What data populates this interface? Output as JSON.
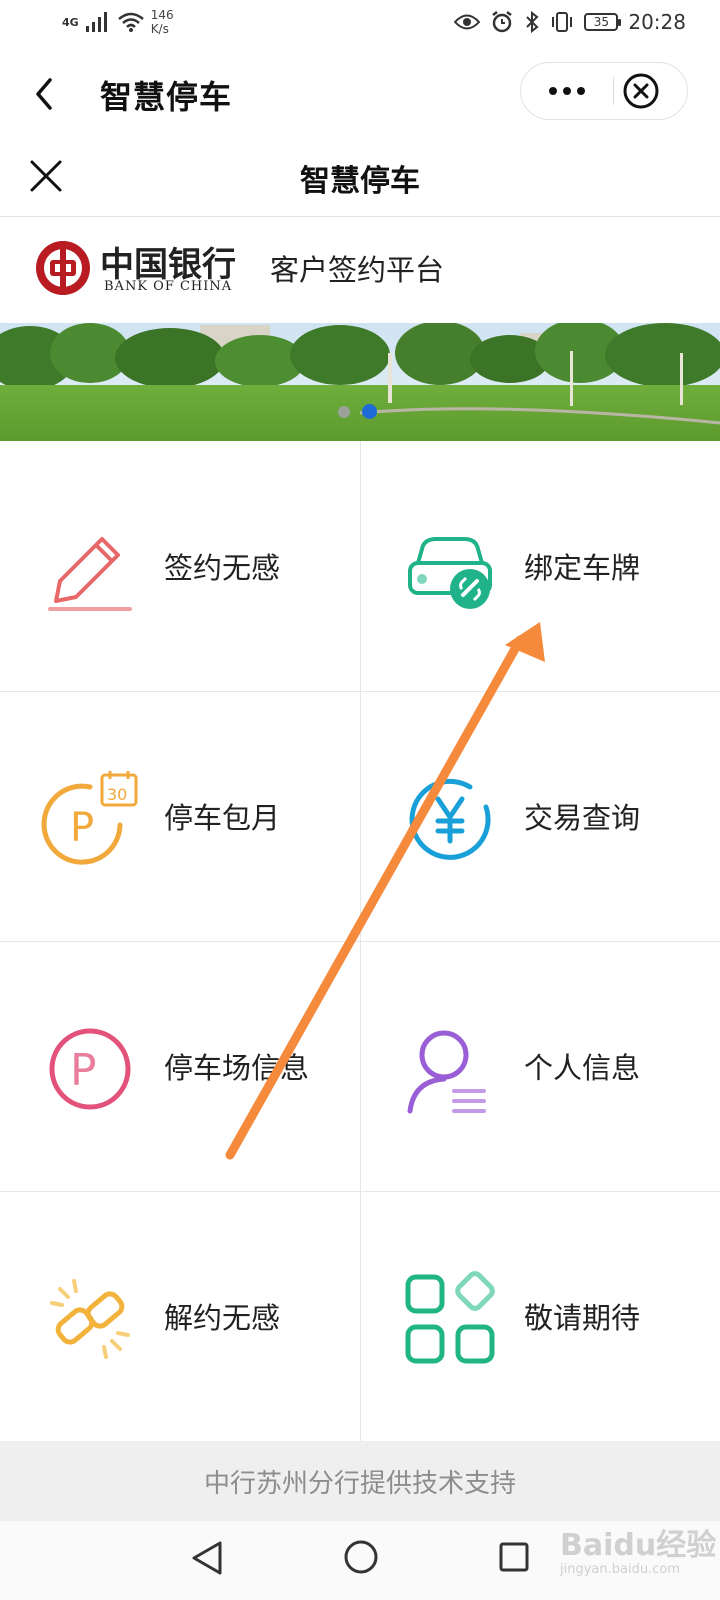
{
  "status_bar": {
    "network": "4G",
    "speed_value": "146",
    "speed_unit": "K/s",
    "battery": "35",
    "time": "20:28"
  },
  "mini_program": {
    "title": "智慧停车",
    "more_icon": "more-dots-icon",
    "close_icon": "close-circle-icon"
  },
  "page": {
    "title": "智慧停车"
  },
  "brand": {
    "logo_cn": "中国银行",
    "logo_en": "BANK OF CHINA",
    "platform": "客户签约平台"
  },
  "banner": {
    "slide_count": 2,
    "active_slide": 2
  },
  "menu": [
    {
      "label": "签约无感",
      "icon": "pencil-icon",
      "color": "#e8686a"
    },
    {
      "label": "绑定车牌",
      "icon": "car-link-icon",
      "color": "#20b38a"
    },
    {
      "label": "停车包月",
      "icon": "parking-calendar-icon",
      "color": "#f2a93b"
    },
    {
      "label": "交易查询",
      "icon": "yen-circle-icon",
      "color": "#1aa0d8"
    },
    {
      "label": "停车场信息",
      "icon": "parking-circle-icon",
      "color": "#e2527a"
    },
    {
      "label": "个人信息",
      "icon": "person-icon",
      "color": "#9a5fd6"
    },
    {
      "label": "解约无感",
      "icon": "broken-link-icon",
      "color": "#f2b23b"
    },
    {
      "label": "敬请期待",
      "icon": "grid-apps-icon",
      "color": "#22b584"
    }
  ],
  "footer": {
    "text": "中行苏州分行提供技术支持"
  },
  "watermark": {
    "text": "Baidu经验",
    "sub": "jingyan.baidu.com"
  },
  "colors": {
    "brand_red": "#b81c22",
    "accent_blue": "#1e6bd6",
    "annotation_arrow": "#f58a3c"
  }
}
